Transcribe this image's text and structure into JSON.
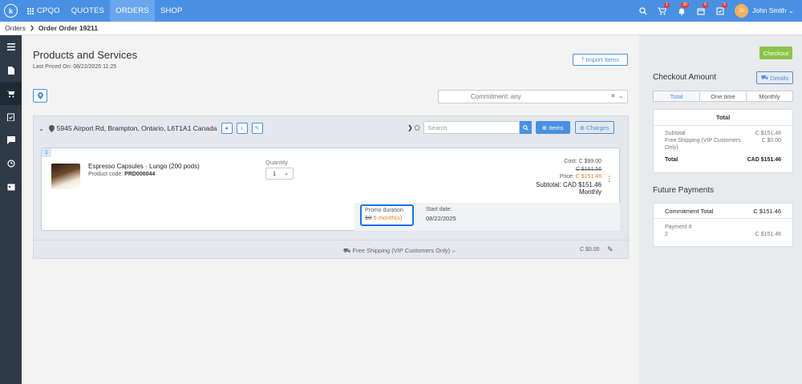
{
  "topbar": {
    "brand": "CPQO",
    "nav": [
      {
        "label": "QUOTES"
      },
      {
        "label": "ORDERS"
      },
      {
        "label": "SHOP"
      }
    ],
    "badges": {
      "cart": "1",
      "bell": "30",
      "calendar": "6",
      "tasks": "5"
    },
    "avatar_initials": "JS",
    "username": "John Smith"
  },
  "breadcrumb": {
    "root": "Orders",
    "current": "Order Order 19211"
  },
  "main": {
    "title": "Products and Services",
    "last_priced": "Last Priced On: 08/22/2025 11:25",
    "import_label": "Import Items",
    "commitment_placeholder": "Commitment: any"
  },
  "location": {
    "address": "5945 Airport Rd, Brampton, Ontario, L6T1A1 Canada",
    "search_placeholder": "Search",
    "items_label": "Items",
    "charges_label": "Charges"
  },
  "item": {
    "number": "1",
    "name": "Espresso Capsules - Lungo (200 pods)",
    "code_label": "Product code:",
    "code": "PRD000044",
    "qty_label": "Quantity",
    "qty_value": "1",
    "cost": "Cost: C $99.00",
    "original_price": "C $161.56",
    "price_label": "Price:",
    "price": "C $151.46",
    "subtotal": "Subtotal: CAD $151.46",
    "period": "Monthly",
    "promo_label": "Promo duration",
    "promo_old": "10",
    "promo_new": "5 month(s)",
    "start_label": "Start date:",
    "start_value": "08/22/2025"
  },
  "shipping": {
    "label": "Free Shipping (VIP Customers Only)",
    "amount": "C $0.00"
  },
  "checkout": {
    "button": "Checkout",
    "title": "Checkout Amount",
    "details": "Details",
    "tabs": [
      "Total",
      "One time",
      "Monthly"
    ],
    "card_title": "Total",
    "subtotal_label": "Subtotal",
    "subtotal_value": "C $151.46",
    "shipping_label": "Free Shipping (VIP Customers Only)",
    "shipping_value": "C $0.00",
    "total_label": "Total",
    "total_value": "CAD $151.46"
  },
  "future": {
    "title": "Future Payments",
    "commitment_label": "Commitment Total",
    "commitment_value": "C $151.46",
    "payment_label": "Payment #",
    "payment_num": "2",
    "payment_value": "C $151.46"
  },
  "colors": {
    "primary": "#4a90e2",
    "sidebar": "#2e3a46",
    "checkout": "#8bc34a",
    "promo": "#e67e22"
  }
}
